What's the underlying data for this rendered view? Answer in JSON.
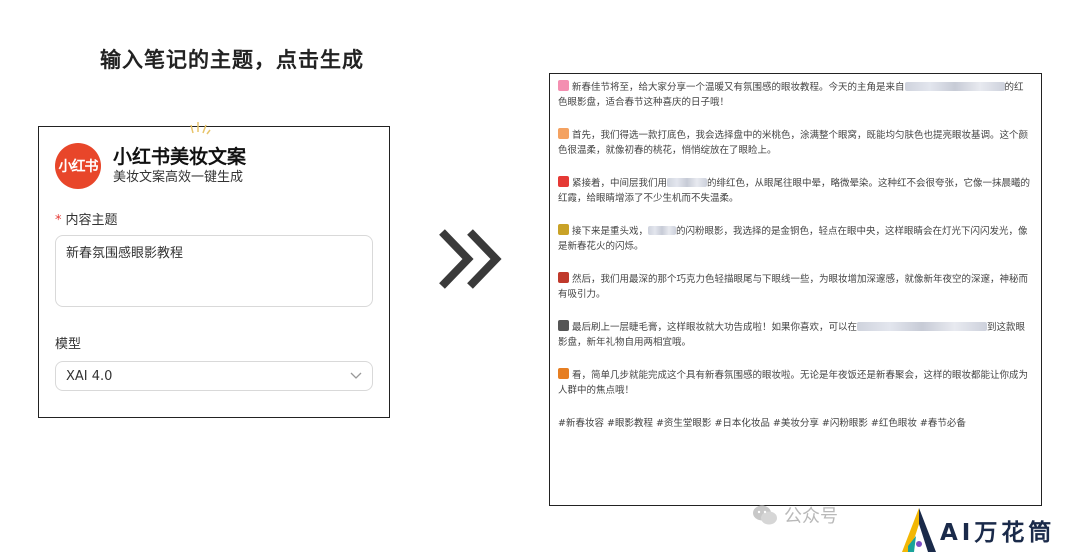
{
  "caption": "输入笔记的主题，点击生成",
  "form": {
    "logo_text": "小红书",
    "app_title": "小红书美妆文案",
    "app_subtitle": "美妆文案高效一键生成",
    "topic_label": "内容主题",
    "topic_required_mark": "*",
    "topic_value": "新春氛围感眼影教程",
    "model_label": "模型",
    "model_value": "XAI 4.0"
  },
  "result": {
    "paragraphs": [
      {
        "icon": "flower-icon",
        "color": "#f48fb1",
        "before": "新春佳节将至，给大家分享一个温暖又有氛围感的眼妆教程。今天的主角是来自",
        "after": "的红色眼影盘，适合春节这种喜庆的日子哦！",
        "blur_width": 100
      },
      {
        "icon": "peach-icon",
        "color": "#f4a261",
        "before": "首先，我们得选一款打底色，我会选择盘中的米桃色，涂满整个眼窝，既能均匀肤色也提亮眼妆基调。这个颜色很温柔，就像初春的桃花，悄悄绽放在了眼睑上。",
        "after": "",
        "blur_width": 0
      },
      {
        "icon": "rose-icon",
        "color": "#e53935",
        "before": "紧接着，中间层我们用",
        "after": "的绯红色，从眼尾往眼中晕，略微晕染。这种红不会很夸张，它像一抹晨曦的红霞，给眼睛增添了不少生机而不失温柔。",
        "blur_width": 40
      },
      {
        "icon": "sparkle-icon",
        "color": "#c9a227",
        "before": "接下来是重头戏，",
        "after": "的闪粉眼影，我选择的是金铜色，轻点在眼中央，这样眼睛会在灯光下闪闪发光，像是新春花火的闪烁。",
        "blur_width": 28
      },
      {
        "icon": "lipstick-icon",
        "color": "#c0392b",
        "before": "然后，我们用最深的那个巧克力色轻描眼尾与下眼线一些，为眼妆增加深邃感，就像新年夜空的深邃，神秘而有吸引力。",
        "after": "",
        "blur_width": 0
      },
      {
        "icon": "eye-icon",
        "color": "#555555",
        "before": "最后刷上一层睫毛膏，这样眼妆就大功告成啦！如果你喜欢，可以在",
        "after": "到这款眼影盘，新年礼物自用两相宜哦。",
        "blur_width": 130
      },
      {
        "icon": "gift-icon",
        "color": "#e67e22",
        "before": "看，简单几步就能完成这个具有新春氛围感的眼妆啦。无论是年夜饭还是新春聚会，这样的眼妆都能让你成为人群中的焦点哦！",
        "after": "",
        "blur_width": 0
      }
    ],
    "hashtags": "#新春妆容 #眼影教程 #资生堂眼影 #日本化妆品 #美妆分享 #闪粉眼影 #红色眼妆 #春节必备"
  },
  "watermark": {
    "text": "公众号"
  },
  "brand": {
    "text": "AI万花筒"
  }
}
